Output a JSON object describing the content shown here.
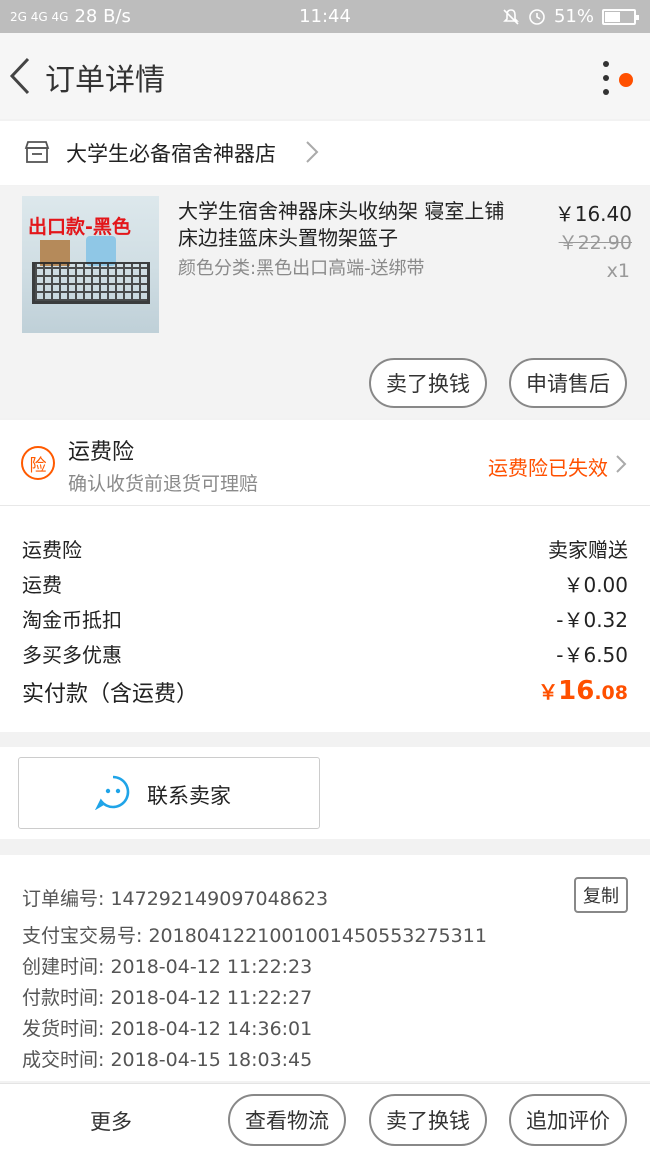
{
  "status_bar": {
    "network": "2G 4G 4G",
    "speed": "28 B/s",
    "time": "11:44",
    "battery": "51%",
    "battery_level": 0.51
  },
  "header": {
    "title": "订单详情"
  },
  "shop": {
    "name": "大学生必备宿舍神器店"
  },
  "product": {
    "image_label": "出口款-黑色",
    "title": "大学生宿舍神器床头收纳架 寝室上铺床边挂篮床头置物架篮子",
    "sku": "颜色分类:黑色出口高端-送绑带",
    "price": "￥16.40",
    "original_price": "￥22.90",
    "quantity": "x1",
    "actions": [
      "卖了换钱",
      "申请售后"
    ]
  },
  "insurance": {
    "icon_text": "险",
    "title": "运费险",
    "subtitle": "确认收货前退货可理赔",
    "status": "运费险已失效"
  },
  "costs": [
    {
      "label": "运费险",
      "value": "卖家赠送"
    },
    {
      "label": "运费",
      "value": "￥0.00"
    },
    {
      "label": "淘金币抵扣",
      "value": "-￥0.32"
    },
    {
      "label": "多买多优惠",
      "value": "-￥6.50"
    }
  ],
  "total": {
    "label": "实付款（含运费）",
    "currency": "￥",
    "integer": "16",
    "decimal": ".08"
  },
  "contact": {
    "label": "联系卖家"
  },
  "order_info": {
    "copy_label": "复制",
    "lines": [
      "订单编号: 147292149097048623",
      "支付宝交易号: 2018041221001001450553275311",
      "创建时间: 2018-04-12 11:22:23",
      "付款时间: 2018-04-12 11:22:27",
      "发货时间: 2018-04-12 14:36:01",
      "成交时间: 2018-04-15 18:03:45"
    ]
  },
  "bottom_bar": {
    "more": "更多",
    "buttons": [
      "查看物流",
      "卖了换钱",
      "追加评价"
    ]
  },
  "colors": {
    "accent": "#ff5000",
    "status_bar": "#bdbdbd"
  }
}
